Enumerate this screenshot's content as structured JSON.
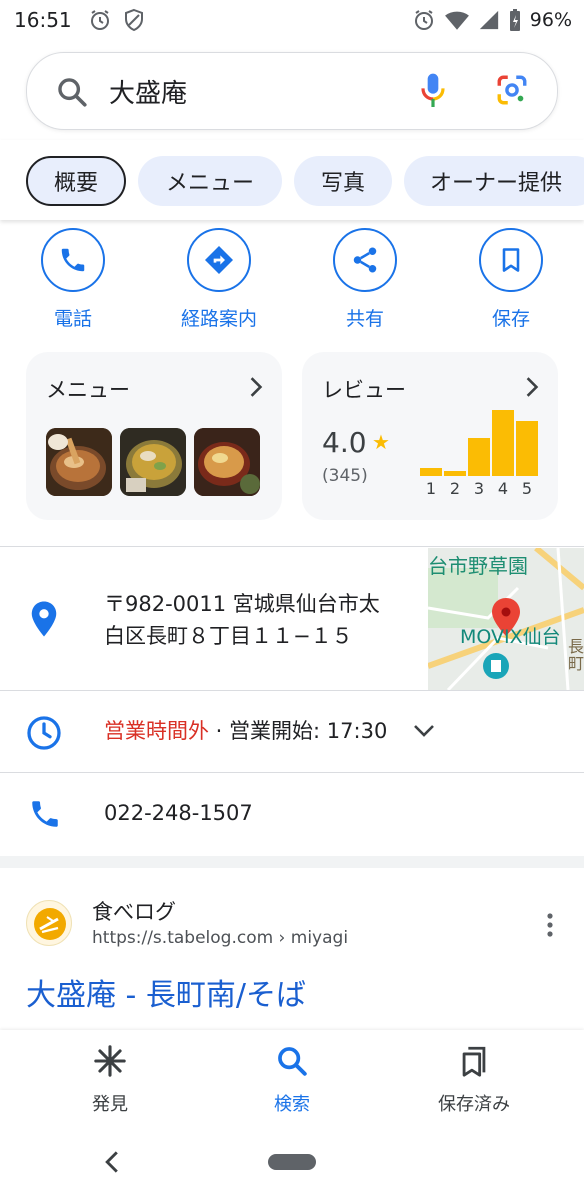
{
  "status_bar": {
    "time": "16:51",
    "battery": "96%"
  },
  "search": {
    "query": "大盛庵"
  },
  "tabs": [
    {
      "label": "概要",
      "active": true
    },
    {
      "label": "メニュー",
      "active": false
    },
    {
      "label": "写真",
      "active": false
    },
    {
      "label": "オーナー提供",
      "active": false
    }
  ],
  "actions": [
    {
      "label": "電話",
      "icon": "phone-icon"
    },
    {
      "label": "経路案内",
      "icon": "directions-icon"
    },
    {
      "label": "共有",
      "icon": "share-icon"
    },
    {
      "label": "保存",
      "icon": "bookmark-icon"
    }
  ],
  "menu_card": {
    "title": "メニュー"
  },
  "review_card": {
    "title": "レビュー",
    "rating": "4.0",
    "count": "(345)",
    "bars": [
      {
        "label": "1",
        "fraction": 0.12
      },
      {
        "label": "2",
        "fraction": 0.07
      },
      {
        "label": "3",
        "fraction": 0.58
      },
      {
        "label": "4",
        "fraction": 1.0
      },
      {
        "label": "5",
        "fraction": 0.83
      }
    ]
  },
  "address": {
    "line1": "〒982-0011 宮城県仙台市太",
    "line2": "白区長町８丁目１１−１５"
  },
  "map": {
    "label_top": "台市野草園",
    "label_movix": "MOVIX仙台",
    "label_side": "長町"
  },
  "hours": {
    "status": "営業時間外",
    "separator": " · ",
    "opens": "営業開始: 17:30"
  },
  "phone": {
    "number": "022-248-1507"
  },
  "result": {
    "site_name": "食べログ",
    "url": "https://s.tabelog.com › miyagi",
    "title": "大盛庵 - 長町南/そば"
  },
  "bottom_nav": [
    {
      "label": "発見",
      "icon": "discover-icon",
      "active": false
    },
    {
      "label": "検索",
      "icon": "search-icon",
      "active": true
    },
    {
      "label": "保存済み",
      "icon": "saved-icon",
      "active": false
    }
  ],
  "colors": {
    "accent": "#1a73e8",
    "rating": "#fbbc04",
    "closed": "#d93025",
    "chip_bg": "#e8eefc"
  }
}
